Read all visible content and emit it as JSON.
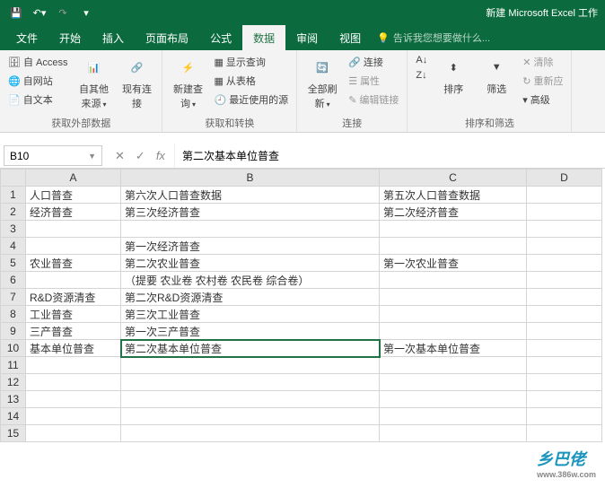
{
  "titlebar": {
    "title": "新建 Microsoft Excel 工作"
  },
  "tabs": {
    "items": [
      "文件",
      "开始",
      "插入",
      "页面布局",
      "公式",
      "数据",
      "审阅",
      "视图"
    ],
    "active": 5,
    "tell_me": "告诉我您想要做什么..."
  },
  "ribbon": {
    "g1": {
      "label": "获取外部数据",
      "access": "自 Access",
      "web": "自网站",
      "text": "自文本",
      "other": "自其他来源",
      "conn": "现有连接"
    },
    "g2": {
      "label": "获取和转换",
      "newq": "新建查询",
      "show": "显示查询",
      "table": "从表格",
      "recent": "最近使用的源"
    },
    "g3": {
      "label": "连接",
      "refresh": "全部刷新",
      "conn": "连接",
      "prop": "属性",
      "edit": "编辑链接"
    },
    "g4": {
      "label": "排序和筛选",
      "sort": "排序",
      "filter": "筛选",
      "clear": "清除",
      "reapply": "重新应",
      "adv": "高级"
    }
  },
  "namebox": "B10",
  "formula": "第二次基本单位普查",
  "columns": [
    "A",
    "B",
    "C",
    "D"
  ],
  "rows": [
    {
      "n": 1,
      "A": "人口普查",
      "B": "第六次人口普查数据",
      "C": "第五次人口普查数据",
      "D": ""
    },
    {
      "n": 2,
      "A": "经济普查",
      "B": "第三次经济普查",
      "C": "第二次经济普查",
      "D": ""
    },
    {
      "n": 3,
      "A": "",
      "B": "",
      "C": "",
      "D": ""
    },
    {
      "n": 4,
      "A": "",
      "B": "第一次经济普查",
      "C": "",
      "D": ""
    },
    {
      "n": 5,
      "A": "农业普查",
      "B": "第二次农业普查",
      "C": "第一次农业普查",
      "D": ""
    },
    {
      "n": 6,
      "A": "",
      "B": "（提要 农业卷 农村卷 农民卷 综合卷）",
      "C": "",
      "D": ""
    },
    {
      "n": 7,
      "A": "R&D资源清查",
      "B": "第二次R&D资源清查",
      "C": "",
      "D": ""
    },
    {
      "n": 8,
      "A": "工业普查",
      "B": "第三次工业普查",
      "C": "",
      "D": ""
    },
    {
      "n": 9,
      "A": "三产普查",
      "B": "第一次三产普查",
      "C": "",
      "D": ""
    },
    {
      "n": 10,
      "A": "基本单位普查",
      "B": "第二次基本单位普查",
      "C": "第一次基本单位普查",
      "D": ""
    },
    {
      "n": 11,
      "A": "",
      "B": "",
      "C": "",
      "D": ""
    },
    {
      "n": 12,
      "A": "",
      "B": "",
      "C": "",
      "D": ""
    },
    {
      "n": 13,
      "A": "",
      "B": "",
      "C": "",
      "D": ""
    },
    {
      "n": 14,
      "A": "",
      "B": "",
      "C": "",
      "D": ""
    },
    {
      "n": 15,
      "A": "",
      "B": "",
      "C": "",
      "D": ""
    }
  ],
  "selected": {
    "row": 10,
    "col": "B"
  },
  "watermark": {
    "main": "乡巴佬",
    "url": "www.386w.com"
  }
}
